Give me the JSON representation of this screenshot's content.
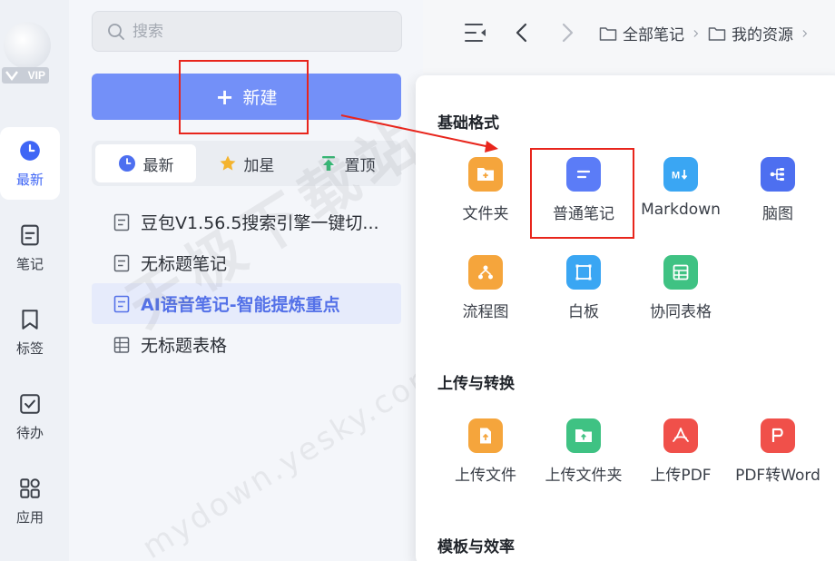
{
  "sidebar": {
    "vip_badge": "VIP",
    "items": [
      {
        "label": "最新",
        "icon": "clock-icon",
        "active": true
      },
      {
        "label": "笔记",
        "icon": "note-icon"
      },
      {
        "label": "标签",
        "icon": "bookmark-icon"
      },
      {
        "label": "待办",
        "icon": "checkbox-icon"
      },
      {
        "label": "应用",
        "icon": "apps-grid-icon"
      }
    ]
  },
  "search": {
    "placeholder": "搜索"
  },
  "new_button": {
    "label": "新建"
  },
  "filter_tabs": [
    {
      "label": "最新",
      "icon": "clock-icon",
      "active": true
    },
    {
      "label": "加星",
      "icon": "star-icon"
    },
    {
      "label": "置顶",
      "icon": "pin-top-icon"
    }
  ],
  "notes": [
    {
      "title": "豆包V1.56.5搜索引擎一键切...",
      "type": "note"
    },
    {
      "title": "无标题笔记",
      "type": "note"
    },
    {
      "title": "AI语音笔记-智能提炼重点",
      "type": "note",
      "active": true
    },
    {
      "title": "无标题表格",
      "type": "table"
    }
  ],
  "breadcrumb": [
    "全部笔记",
    "我的资源"
  ],
  "create_menu": {
    "sections": [
      {
        "title": "基础格式",
        "items": [
          {
            "label": "文件夹",
            "icon": "folder-add-icon",
            "color": "#f5a53c"
          },
          {
            "label": "普通笔记",
            "icon": "note-lines-icon",
            "color": "#5b7cf7"
          },
          {
            "label": "Markdown",
            "icon": "markdown-icon",
            "color": "#3aa6f3"
          },
          {
            "label": "脑图",
            "icon": "mindmap-icon",
            "color": "#4d6ff0"
          },
          {
            "label": "流程图",
            "icon": "flowchart-icon",
            "color": "#f5a53c"
          },
          {
            "label": "白板",
            "icon": "whiteboard-icon",
            "color": "#3aa6f3"
          },
          {
            "label": "协同表格",
            "icon": "table-icon",
            "color": "#3fc283"
          }
        ]
      },
      {
        "title": "上传与转换",
        "items": [
          {
            "label": "上传文件",
            "icon": "upload-file-icon",
            "color": "#f5a53c"
          },
          {
            "label": "上传文件夹",
            "icon": "upload-folder-icon",
            "color": "#3fc283"
          },
          {
            "label": "上传PDF",
            "icon": "pdf-icon",
            "color": "#f0504a"
          },
          {
            "label": "PDF转Word",
            "icon": "pdf-to-word-icon",
            "color": "#f0504a"
          }
        ]
      },
      {
        "title": "模板与效率",
        "items": []
      }
    ]
  },
  "watermark": {
    "line1": "天极下载站",
    "line2": "mydown.yesky.com"
  }
}
